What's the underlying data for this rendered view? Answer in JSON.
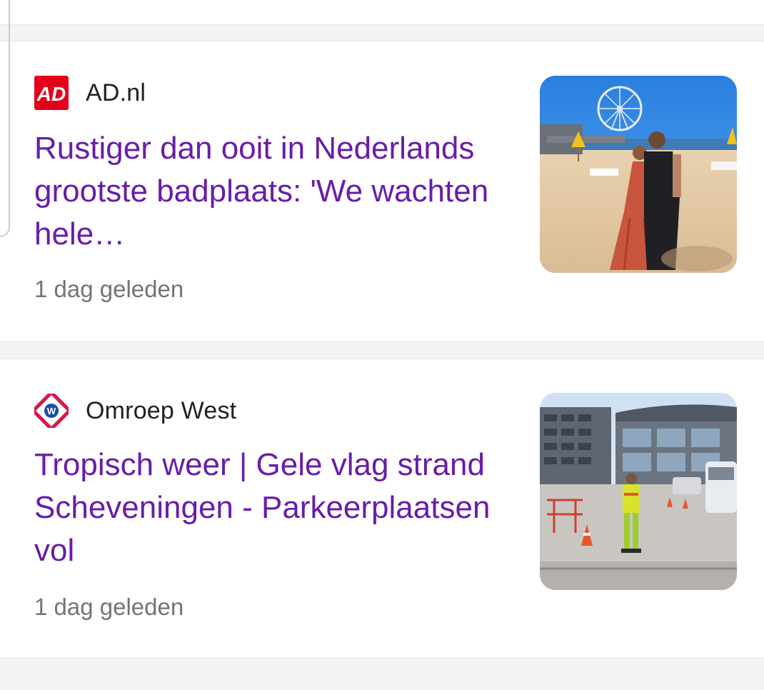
{
  "articles": [
    {
      "source": "AD.nl",
      "source_logo_text": "AD",
      "headline": "Rustiger dan ooit in Nederlands grootste badplaats: 'We wachten hele…",
      "time": "1 dag geleden",
      "thumbnail": "beach-photo"
    },
    {
      "source": "Omroep West",
      "source_logo_text": "W",
      "headline": "Tropisch weer | Gele vlag strand Scheveningen - Parkeerplaatsen vol",
      "time": "1 dag geleden",
      "thumbnail": "street-photo"
    }
  ],
  "colors": {
    "headline": "#681da8",
    "source": "#202124",
    "time": "#70757a",
    "ad_brand": "#e3001b",
    "omroep_west_brand": "#d6184a"
  }
}
